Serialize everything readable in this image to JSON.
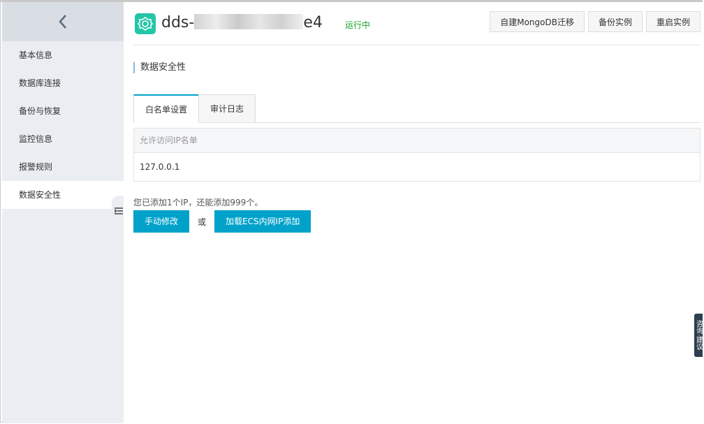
{
  "sidebar": {
    "items": [
      {
        "label": "基本信息"
      },
      {
        "label": "数据库连接"
      },
      {
        "label": "备份与恢复"
      },
      {
        "label": "监控信息"
      },
      {
        "label": "报警规则"
      },
      {
        "label": "数据安全性"
      }
    ],
    "active_index": 5
  },
  "header": {
    "title_prefix": "dds-",
    "title_suffix": "e4",
    "status": "运行中",
    "buttons": [
      "自建MongoDB迁移",
      "备份实例",
      "重启实例"
    ]
  },
  "section": {
    "title": "数据安全性"
  },
  "tabs": [
    {
      "label": "白名单设置"
    },
    {
      "label": "审计日志"
    }
  ],
  "whitelist": {
    "column_header": "允许访问IP名单",
    "rows": [
      "127.0.0.1"
    ]
  },
  "note": "您已添加1个IP，还能添加999个。",
  "actions": {
    "manual_edit": "手动修改",
    "or": "或",
    "load_ecs": "加载ECS内网IP添加"
  },
  "consult": "咨询·建议",
  "colors": {
    "accent": "#00a2ca",
    "status": "#1e9e28",
    "logo": "#23c6a8"
  },
  "icons": [
    "back-chevron-icon",
    "collapse-sidebar-icon",
    "mongodb-instance-logo-icon"
  ]
}
